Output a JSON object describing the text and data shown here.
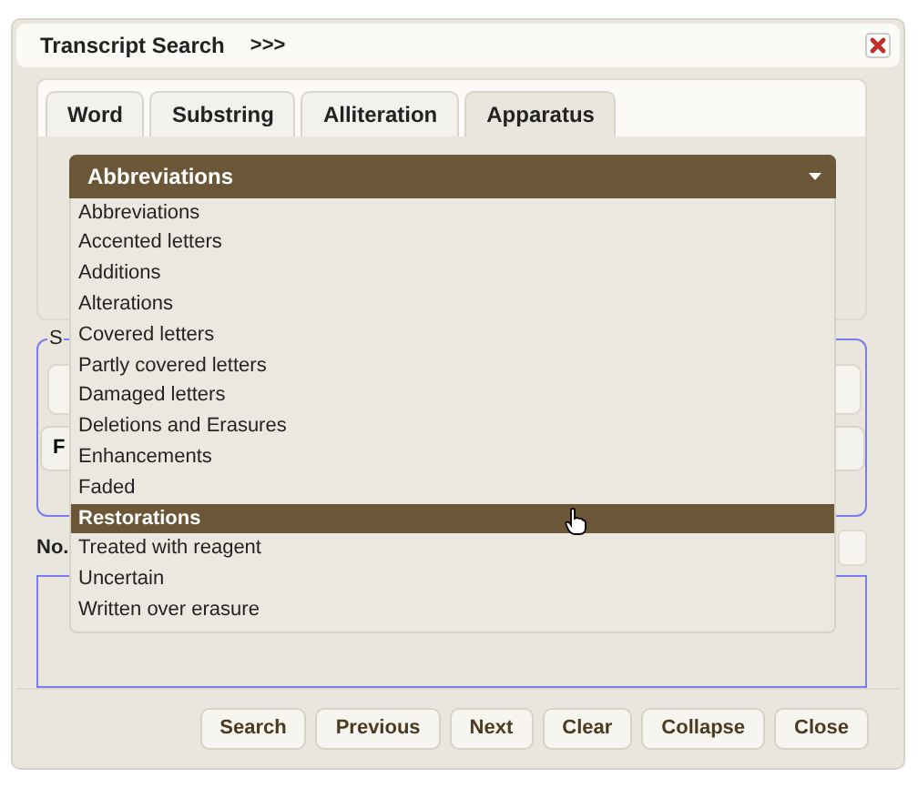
{
  "window": {
    "title": "Transcript Search",
    "expand_label": ">>>"
  },
  "tabs": [
    {
      "label": "Word",
      "selected": false
    },
    {
      "label": "Substring",
      "selected": false
    },
    {
      "label": "Alliteration",
      "selected": false
    },
    {
      "label": "Apparatus",
      "selected": true
    }
  ],
  "select": {
    "value": "Abbreviations",
    "options": [
      {
        "label": "Abbreviations",
        "highlighted": false
      },
      {
        "label": "Accented letters",
        "highlighted": false
      },
      {
        "label": "Additions",
        "highlighted": false
      },
      {
        "label": "Alterations",
        "highlighted": false
      },
      {
        "label": "Covered letters",
        "highlighted": false
      },
      {
        "label": "Partly covered letters",
        "highlighted": false
      },
      {
        "label": "Damaged letters",
        "highlighted": false
      },
      {
        "label": "Deletions and Erasures",
        "highlighted": false
      },
      {
        "label": "Enhancements",
        "highlighted": false
      },
      {
        "label": "Faded",
        "highlighted": false
      },
      {
        "label": "Restorations",
        "highlighted": true
      },
      {
        "label": "Treated with reagent",
        "highlighted": false
      },
      {
        "label": "Uncertain",
        "highlighted": false
      },
      {
        "label": "Written over erasure",
        "highlighted": false
      }
    ]
  },
  "hidden_form": {
    "legend": "S",
    "button_label": "F",
    "count_label": "No."
  },
  "buttons": [
    "Search",
    "Previous",
    "Next",
    "Clear",
    "Collapse",
    "Close"
  ]
}
